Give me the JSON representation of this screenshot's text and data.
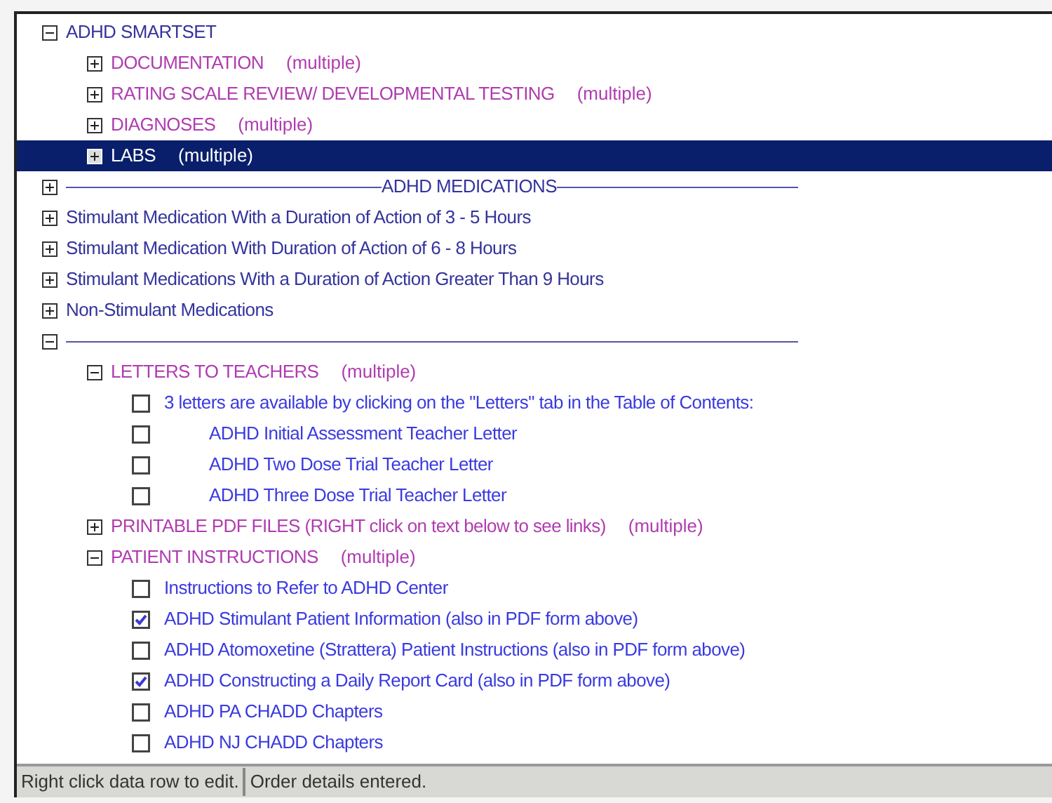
{
  "tree": [
    {
      "kind": "group",
      "label": "ADHD SMARTSET",
      "expanded": true,
      "selected": false,
      "children": [
        {
          "kind": "section",
          "label": "DOCUMENTATION",
          "note": "(multiple)",
          "expanded": false,
          "selected": false
        },
        {
          "kind": "section",
          "label": "RATING SCALE REVIEW/ DEVELOPMENTAL TESTING",
          "note": "(multiple)",
          "expanded": false,
          "selected": false
        },
        {
          "kind": "section",
          "label": "DIAGNOSES",
          "note": "(multiple)",
          "expanded": false,
          "selected": false
        },
        {
          "kind": "section",
          "label": "LABS",
          "note": "(multiple)",
          "expanded": false,
          "selected": true
        }
      ]
    },
    {
      "kind": "divider",
      "label": "ADHD MEDICATIONS",
      "expanded": false,
      "selected": false
    },
    {
      "kind": "group",
      "label": "Stimulant Medication With a Duration of Action of 3 - 5 Hours",
      "expanded": false,
      "selected": false
    },
    {
      "kind": "group",
      "label": "Stimulant Medication With Duration of Action of 6 - 8 Hours",
      "expanded": false,
      "selected": false
    },
    {
      "kind": "group",
      "label": "Stimulant Medications With a Duration of Action Greater Than 9 Hours",
      "expanded": false,
      "selected": false
    },
    {
      "kind": "group",
      "label": "Non-Stimulant Medications",
      "expanded": false,
      "selected": false
    },
    {
      "kind": "divider",
      "expanded": true,
      "selected": false,
      "children": [
        {
          "kind": "section",
          "label": "LETTERS TO TEACHERS",
          "note": "(multiple)",
          "expanded": true,
          "selected": false,
          "children": [
            {
              "kind": "order",
              "label": "3 letters are available by clicking on the \"Letters\" tab in the Table of Contents:",
              "checked": false,
              "selected": false
            },
            {
              "kind": "letter",
              "label": "ADHD Initial Assessment Teacher Letter",
              "checked": false,
              "selected": false
            },
            {
              "kind": "letter",
              "label": "ADHD Two Dose Trial Teacher Letter",
              "checked": false,
              "selected": false
            },
            {
              "kind": "letter",
              "label": "ADHD Three Dose Trial Teacher Letter",
              "checked": false,
              "selected": false
            }
          ]
        },
        {
          "kind": "section",
          "label": "PRINTABLE PDF FILES (RIGHT click on text below to see links)",
          "note": "(multiple)",
          "expanded": false,
          "selected": false
        },
        {
          "kind": "section",
          "label": "PATIENT INSTRUCTIONS",
          "note": "(multiple)",
          "expanded": true,
          "selected": false,
          "children": [
            {
              "kind": "order",
              "label": "Instructions to Refer to ADHD Center",
              "checked": false,
              "selected": false
            },
            {
              "kind": "order",
              "label": "ADHD Stimulant Patient Information (also in PDF form above)",
              "checked": true,
              "selected": false
            },
            {
              "kind": "order",
              "label": "ADHD Atomoxetine (Strattera) Patient Instructions (also in PDF form above)",
              "checked": false,
              "selected": false
            },
            {
              "kind": "order",
              "label": "ADHD Constructing a Daily Report Card (also in PDF form above)",
              "checked": true,
              "selected": false
            },
            {
              "kind": "order",
              "label": "ADHD PA CHADD Chapters",
              "checked": false,
              "selected": false
            },
            {
              "kind": "order",
              "label": "ADHD NJ CHADD Chapters",
              "checked": false,
              "selected": false
            }
          ]
        }
      ]
    }
  ],
  "status_bar": [
    "Right click data row to edit.",
    "Order details entered."
  ]
}
